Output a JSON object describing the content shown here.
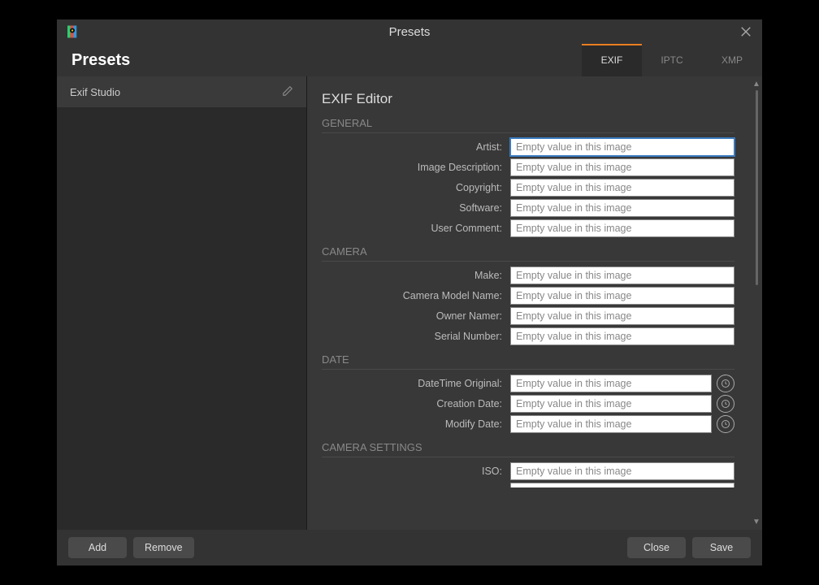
{
  "window": {
    "title": "Presets"
  },
  "heading": "Presets",
  "tabs": {
    "exif": "EXIF",
    "iptc": "IPTC",
    "xmp": "XMP"
  },
  "sidebar": {
    "items": [
      {
        "label": "Exif Studio"
      }
    ]
  },
  "editor": {
    "title": "EXIF Editor",
    "placeholder": "Empty value in this image",
    "sections": {
      "general": {
        "header": "GENERAL",
        "fields": {
          "artist": "Artist:",
          "image_description": "Image Description:",
          "copyright": "Copyright:",
          "software": "Software:",
          "user_comment": "User Comment:"
        }
      },
      "camera": {
        "header": "CAMERA",
        "fields": {
          "make": "Make:",
          "camera_model_name": "Camera Model Name:",
          "owner_name": "Owner Namer:",
          "serial_number": "Serial Number:"
        }
      },
      "date": {
        "header": "DATE",
        "fields": {
          "datetime_original": "DateTime Original:",
          "creation_date": "Creation Date:",
          "modify_date": "Modify Date:"
        }
      },
      "camera_settings": {
        "header": "CAMERA SETTINGS",
        "fields": {
          "iso": "ISO:"
        }
      }
    }
  },
  "footer": {
    "add": "Add",
    "remove": "Remove",
    "close": "Close",
    "save": "Save"
  }
}
